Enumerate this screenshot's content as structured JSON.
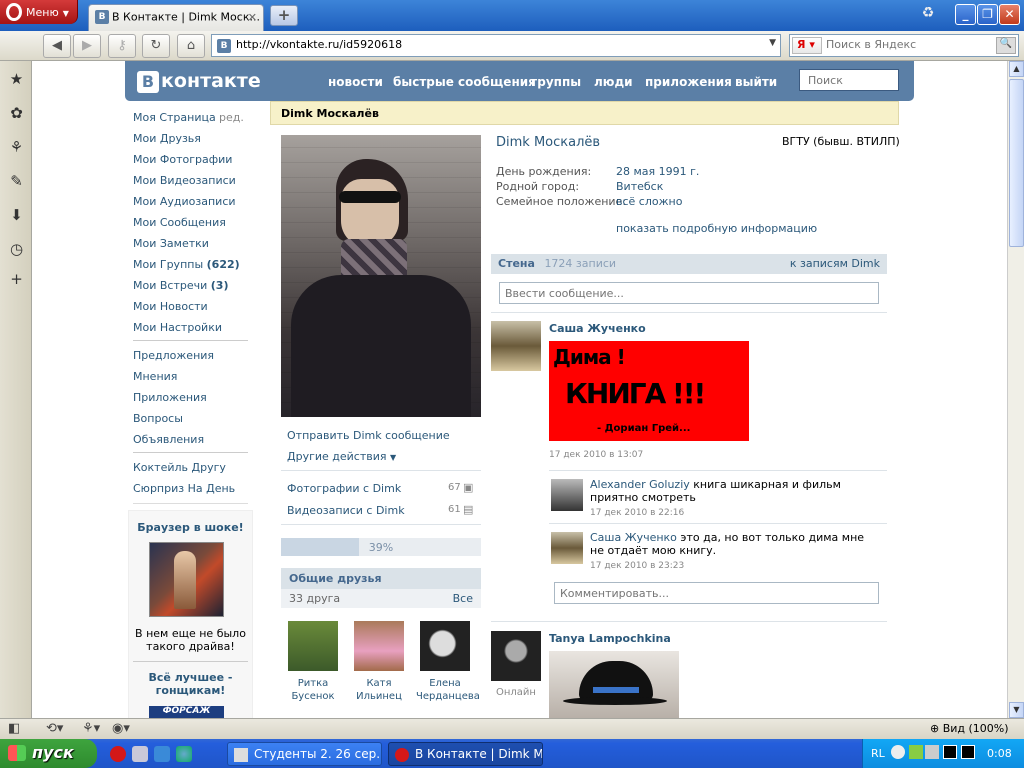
{
  "browser": {
    "menu_label": "Меню",
    "tab_title": "В Контакте | Dimk Моск...",
    "address": "http://vkontakte.ru/id5920618",
    "search_placeholder": "Поиск в Яндекс",
    "search_engine_label": "Я",
    "zoom_label": "Вид (100%)"
  },
  "vk": {
    "logo_text": "контакте",
    "logo_letter": "В",
    "nav": [
      "новости",
      "быстрые сообщения",
      "группы",
      "люди",
      "приложения",
      "выйти"
    ],
    "search_placeholder": "Поиск",
    "leftnav": {
      "my_page": "Моя Страница",
      "edit": "ред.",
      "items": [
        "Мои Друзья",
        "Мои Фотографии",
        "Мои Видеозаписи",
        "Мои Аудиозаписи",
        "Мои Сообщения",
        "Мои Заметки"
      ],
      "groups": "Мои Группы",
      "groups_count": "(622)",
      "events": "Мои Встречи",
      "events_count": "(3)",
      "news": "Мои Новости",
      "settings": "Мои Настройки",
      "items2": [
        "Предложения",
        "Мнения",
        "Приложения",
        "Вопросы",
        "Объявления"
      ],
      "items3": [
        "Коктейль Другу",
        "Сюрприз На День"
      ]
    },
    "ads": [
      {
        "title": "Браузер в шоке!",
        "text": "В нем еще не было такого драйва!"
      },
      {
        "title": "Всё лучшее - гонщикам!",
        "banner": "ФОРСАЖ"
      }
    ],
    "profile_header": "Dimk Москалёв",
    "profile": {
      "name": "Dimk Москалёв",
      "university": "ВГТУ (бывш. ВТИЛП)",
      "fields": [
        {
          "label": "День рождения:",
          "value": "28 мая 1991 г."
        },
        {
          "label": "Родной город:",
          "value": "Витебск"
        },
        {
          "label": "Семейное положение:",
          "value": "всё сложно"
        }
      ],
      "more_info": "показать подробную информацию"
    },
    "actions": {
      "send_message": "Отправить Dimk сообщение",
      "other_actions": "Другие действия",
      "photos_label": "Фотографии с Dimk",
      "photos_count": "67",
      "videos_label": "Видеозаписи с Dimk",
      "videos_count": "61"
    },
    "rating": {
      "percent_label": "39%",
      "fraction": 0.39
    },
    "common_friends": {
      "title": "Общие друзья",
      "count_label": "33 друга",
      "all_label": "Все",
      "friends": [
        {
          "first": "Ритка",
          "last": "Бусенок"
        },
        {
          "first": "Катя",
          "last": "Ильинец"
        },
        {
          "first": "Елена",
          "last": "Черданцева"
        }
      ]
    },
    "wall": {
      "title": "Стена",
      "count": "1724 записи",
      "link": "к записям Dimk",
      "input_placeholder": "Ввести сообщение...",
      "posts": [
        {
          "author": "Саша Жученко",
          "image_text_line1": "Дима !",
          "image_text_line2": "КНИГА !!!",
          "image_text_line3": "- Дориан Грей...",
          "date": "17 дек 2010 в 13:07",
          "comments": [
            {
              "author": "Alexander Goluziy",
              "text": "книга шикарная и фильм приятно смотреть",
              "date": "17 дек 2010 в 22:16"
            },
            {
              "author": "Саша Жученко",
              "text": "это да, но вот только дима мне не отдаёт мою книгу.",
              "date": "17 дек 2010 в 23:23"
            }
          ],
          "comment_placeholder": "Комментировать..."
        },
        {
          "author": "Tanya Lampochkina",
          "status": "Онлайн"
        }
      ]
    }
  },
  "taskbar": {
    "start_label": "пуск",
    "tasks": [
      "Студенты 2. 26 сер...",
      "В Контакте | Dimk M..."
    ],
    "lang": "RL",
    "time": "0:08"
  },
  "colors": {
    "vk_blue": "#5b7fa6",
    "link": "#2b587a",
    "header_yellow": "#f7f1c9",
    "post_red": "#ff0000"
  }
}
